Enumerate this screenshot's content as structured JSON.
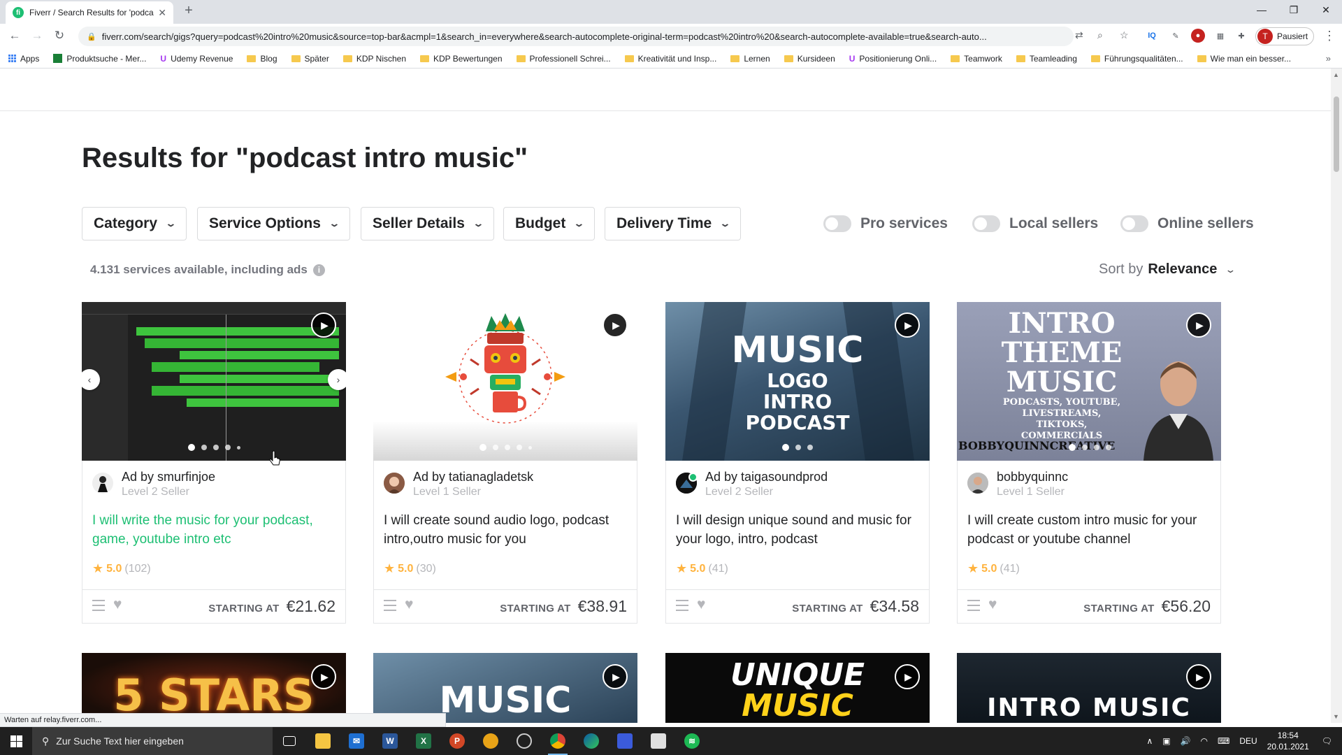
{
  "browser": {
    "tab_title": "Fiverr / Search Results for 'podca",
    "favicon_letter": "fi",
    "url": "fiverr.com/search/gigs?query=podcast%20intro%20music&source=top-bar&acmpl=1&search_in=everywhere&search-autocomplete-original-term=podcast%20intro%20&search-autocomplete-available=true&search-auto...",
    "profile_initial": "T",
    "profile_label": "Pausiert",
    "ext_iq": "IQ",
    "bookmarks": [
      "Apps",
      "Produktsuche - Mer...",
      "Udemy Revenue",
      "Blog",
      "Später",
      "KDP Nischen",
      "KDP Bewertungen",
      "Professionell Schrei...",
      "Kreativität und Insp...",
      "Lernen",
      "Kursideen",
      "Positionierung Onli...",
      "Teamwork",
      "Teamleading",
      "Führungsqualitäten...",
      "Wie man ein besser..."
    ]
  },
  "search": {
    "title": "Results for \"podcast intro music\"",
    "filters": [
      "Category",
      "Service Options",
      "Seller Details",
      "Budget",
      "Delivery Time"
    ],
    "toggles": [
      "Pro services",
      "Local sellers",
      "Online sellers"
    ],
    "count_text": "4.131 services available, including ads",
    "sort_label": "Sort by",
    "sort_value": "Relevance"
  },
  "cards": [
    {
      "seller": "Ad by smurfinjoe",
      "level": "Level 2 Seller",
      "title": "I will write the music for your podcast, game, youtube intro etc",
      "score": "5.0",
      "reviews": "(102)",
      "price_label": "STARTING AT",
      "price": "€21.62"
    },
    {
      "seller": "Ad by tatianagladetsk",
      "level": "Level 1 Seller",
      "title": "I will create sound audio logo, podcast intro,outro music for you",
      "score": "5.0",
      "reviews": "(30)",
      "price_label": "STARTING AT",
      "price": "€38.91"
    },
    {
      "seller": "Ad by taigasoundprod",
      "level": "Level 2 Seller",
      "title": "I will design unique sound and music for your logo, intro, podcast",
      "score": "5.0",
      "reviews": "(41)",
      "price_label": "STARTING AT",
      "price": "€34.58",
      "thumb_lines": [
        "MUSIC",
        "LOGO",
        "INTRO",
        "PODCAST"
      ]
    },
    {
      "seller": "bobbyquinnc",
      "level": "Level 1 Seller",
      "title": "I will create custom intro music for your podcast or youtube channel",
      "score": "5.0",
      "reviews": "(41)",
      "price_label": "STARTING AT",
      "price": "€56.20",
      "thumb_lines": [
        "INTRO THEME",
        "MUSIC",
        "PODCASTS, YOUTUBE,",
        "LIVESTREAMS,",
        "TIKTOKS,",
        "COMMERCIALS",
        "BOBBYQUINNCREATIVE"
      ]
    }
  ],
  "row2_thumbs": [
    "5 STARS",
    "MUSIC",
    "UNIQUE MUSIC",
    "INTRO MUSIC"
  ],
  "status_bar": "Warten auf relay.fiverr.com...",
  "taskbar": {
    "search_placeholder": "Zur Suche Text hier eingeben",
    "lang": "DEU",
    "time": "18:54",
    "date": "20.01.2021"
  }
}
